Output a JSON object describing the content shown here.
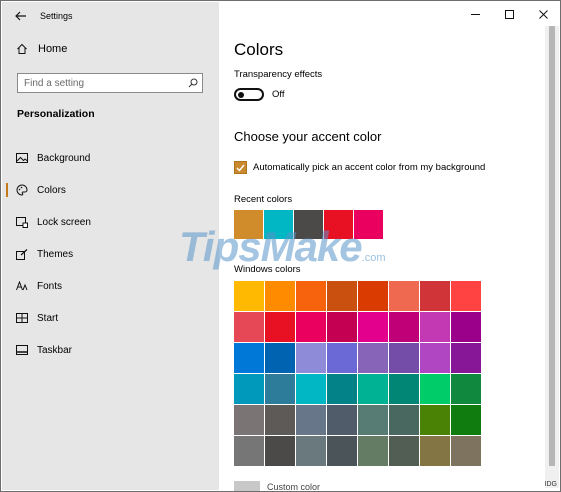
{
  "window": {
    "title": "Settings",
    "controls": [
      "minimize",
      "maximize",
      "close"
    ]
  },
  "sidebar": {
    "home_label": "Home",
    "search_placeholder": "Find a setting",
    "section_title": "Personalization",
    "items": [
      {
        "label": "Background",
        "icon": "image-icon"
      },
      {
        "label": "Colors",
        "icon": "palette-icon",
        "selected": true
      },
      {
        "label": "Lock screen",
        "icon": "lock-screen-icon"
      },
      {
        "label": "Themes",
        "icon": "brush-icon"
      },
      {
        "label": "Fonts",
        "icon": "font-icon"
      },
      {
        "label": "Start",
        "icon": "start-grid-icon"
      },
      {
        "label": "Taskbar",
        "icon": "taskbar-icon"
      }
    ]
  },
  "main": {
    "heading": "Colors",
    "transparency": {
      "label": "Transparency effects",
      "state": "Off"
    },
    "accent_heading": "Choose your accent color",
    "auto_pick": {
      "label": "Automatically pick an accent color from my background",
      "checked": true
    },
    "recent_label": "Recent colors",
    "recent_colors": [
      "#d08b2a",
      "#00b7c3",
      "#4c4a48",
      "#e81123",
      "#ea005e"
    ],
    "windows_label": "Windows colors",
    "windows_colors": [
      "#ffb900",
      "#ff8c00",
      "#f7630c",
      "#ca5010",
      "#da3b01",
      "#ef6950",
      "#d13438",
      "#ff4343",
      "#e74856",
      "#e81123",
      "#ea005e",
      "#c30052",
      "#e3008c",
      "#bf0077",
      "#c239b3",
      "#9a0089",
      "#0078d7",
      "#0063b1",
      "#8e8cd8",
      "#6b69d6",
      "#8764b8",
      "#744da9",
      "#b146c2",
      "#881798",
      "#0099bc",
      "#2d7d9a",
      "#00b7c3",
      "#038387",
      "#00b294",
      "#018574",
      "#00cc6a",
      "#10893e",
      "#7a7574",
      "#5d5a58",
      "#68768a",
      "#515c6b",
      "#567c73",
      "#486860",
      "#498205",
      "#107c10",
      "#767676",
      "#4c4a48",
      "#69797e",
      "#4a5459",
      "#647c64",
      "#525e54",
      "#847545",
      "#7e735f"
    ],
    "custom_color_label": "Custom color"
  },
  "watermark": {
    "main": "TipsMake",
    "suffix": ".com"
  },
  "corner_tag": "IDG"
}
